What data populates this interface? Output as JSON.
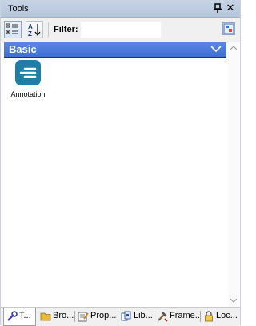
{
  "panel": {
    "title": "Tools"
  },
  "toolbar": {
    "filter_label": "Filter:",
    "filter_value": ""
  },
  "group": {
    "label": "Basic"
  },
  "tools": [
    {
      "label": "Annotation"
    }
  ],
  "tabs": [
    {
      "label": "T..."
    },
    {
      "label": "Bro..."
    },
    {
      "label": "Prop..."
    },
    {
      "label": "Lib..."
    },
    {
      "label": "Frame..."
    },
    {
      "label": "Loc..."
    }
  ]
}
